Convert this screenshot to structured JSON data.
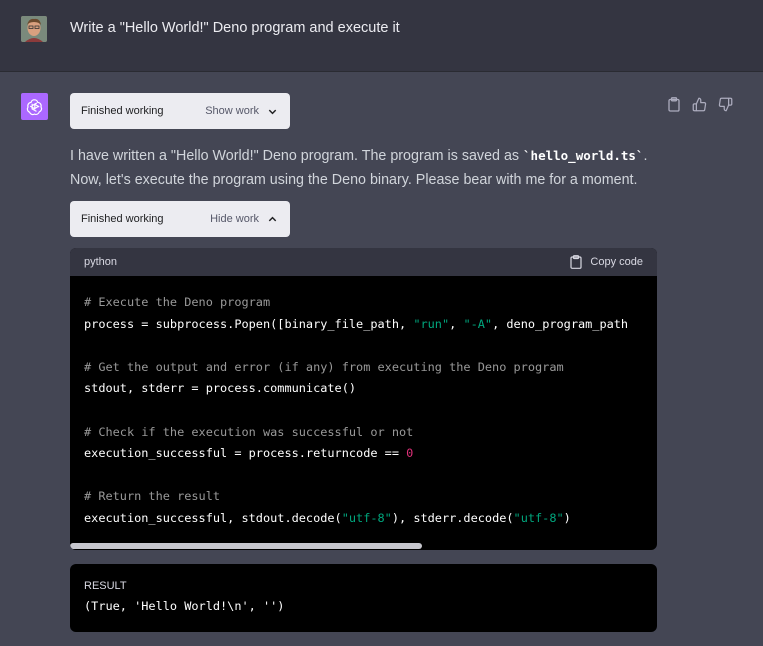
{
  "user": {
    "message": "Write a \"Hello World!\" Deno program and execute it"
  },
  "assistant": {
    "work_blocks": [
      {
        "status": "Finished working",
        "toggle_label": "Show work"
      },
      {
        "status": "Finished working",
        "toggle_label": "Hide work"
      }
    ],
    "message_part1": "I have written a \"Hello World!\" Deno program. The program is saved as ",
    "message_code": "`hello_world.ts`",
    "message_part2": ". Now, let's execute the program using the Deno binary. Please bear with me for a moment."
  },
  "actions": [
    "clipboard-icon",
    "thumbs-up-icon",
    "thumbs-down-icon"
  ],
  "code": {
    "language": "python",
    "copy_label": "Copy code",
    "lines": [
      {
        "segments": [
          {
            "t": "# Execute the Deno program",
            "c": "cm"
          }
        ]
      },
      {
        "segments": [
          {
            "t": "process = subprocess.Popen([binary_file_path, ",
            "c": ""
          },
          {
            "t": "\"run\"",
            "c": "str"
          },
          {
            "t": ", ",
            "c": ""
          },
          {
            "t": "\"-A\"",
            "c": "str"
          },
          {
            "t": ", deno_program_path",
            "c": ""
          }
        ]
      },
      {
        "segments": []
      },
      {
        "segments": [
          {
            "t": "# Get the output and error (if any) from executing the Deno program",
            "c": "cm"
          }
        ]
      },
      {
        "segments": [
          {
            "t": "stdout, stderr = process.communicate()",
            "c": ""
          }
        ]
      },
      {
        "segments": []
      },
      {
        "segments": [
          {
            "t": "# Check if the execution was successful or not",
            "c": "cm"
          }
        ]
      },
      {
        "segments": [
          {
            "t": "execution_successful = process.returncode == ",
            "c": ""
          },
          {
            "t": "0",
            "c": "num"
          }
        ]
      },
      {
        "segments": []
      },
      {
        "segments": [
          {
            "t": "# Return the result",
            "c": "cm"
          }
        ]
      },
      {
        "segments": [
          {
            "t": "execution_successful, stdout.decode(",
            "c": ""
          },
          {
            "t": "\"utf-8\"",
            "c": "str"
          },
          {
            "t": "), stderr.decode(",
            "c": ""
          },
          {
            "t": "\"utf-8\"",
            "c": "str"
          },
          {
            "t": ")",
            "c": ""
          }
        ]
      }
    ]
  },
  "result": {
    "label": "RESULT",
    "value": "(True, 'Hello World!\\n', '')"
  },
  "colors": {
    "background": "#444654",
    "user_row": "#343541",
    "assistant_avatar": "#ab68ff",
    "code_bg": "#000000",
    "string": "#00a67d",
    "number": "#df3079",
    "comment": "#999999"
  }
}
